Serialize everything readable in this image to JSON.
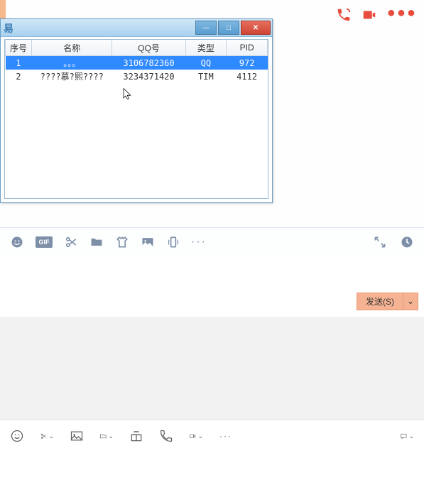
{
  "top_icons": {
    "phone": "phone",
    "video": "video",
    "more": "●●●"
  },
  "window": {
    "minimize": "—",
    "maximize": "□",
    "close": "✕",
    "columns": [
      "序号",
      "名称",
      "QQ号",
      "类型",
      "PID"
    ],
    "col_keys": [
      "idx",
      "name",
      "qq",
      "type",
      "pid"
    ],
    "rows": [
      {
        "idx": "1",
        "name": "。。。",
        "qq": "3106782360",
        "type": "QQ",
        "pid": "972",
        "selected": true
      },
      {
        "idx": "2",
        "name": "????慕?熙????",
        "qq": "3234371420",
        "type": "TIM",
        "pid": "4112",
        "selected": false
      }
    ]
  },
  "mid_toolbar": {
    "emoji": "emoji",
    "gif": "GIF",
    "scissors": "scissors",
    "folder": "folder",
    "tshirt": "tshirt",
    "image": "image",
    "phone_shake": "phone-shake",
    "more": "···",
    "expand": "expand",
    "history": "history"
  },
  "send": {
    "label": "发送(S)",
    "drop": "⌄"
  },
  "bottom_toolbar": {
    "emoji": "emoji",
    "scissors": "scissors",
    "image": "image",
    "folder": "folder",
    "gift": "gift",
    "phone": "phone",
    "video": "video",
    "more": "···",
    "chat": "chat"
  }
}
